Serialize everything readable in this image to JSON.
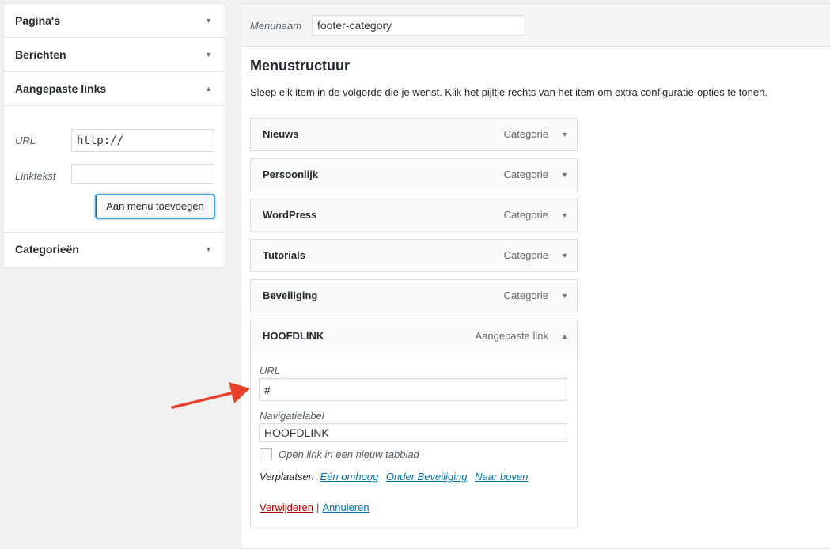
{
  "left_panel": {
    "sections": [
      {
        "label": "Pagina's"
      },
      {
        "label": "Berichten"
      },
      {
        "label": "Aangepaste links"
      },
      {
        "label": "Categorieën"
      }
    ],
    "custom_links": {
      "url_label": "URL",
      "url_value": "http://",
      "linktext_label": "Linktekst",
      "linktext_value": "",
      "add_button": "Aan menu toevoegen"
    }
  },
  "menu": {
    "name_label": "Menunaam",
    "name_value": "footer-category",
    "structure_title": "Menustructuur",
    "structure_desc": "Sleep elk item in de volgorde die je wenst. Klik het pijltje rechts van het item om extra configuratie-opties te tonen.",
    "items": [
      {
        "title": "Nieuws",
        "type": "Categorie"
      },
      {
        "title": "Persoonlijk",
        "type": "Categorie"
      },
      {
        "title": "WordPress",
        "type": "Categorie"
      },
      {
        "title": "Tutorials",
        "type": "Categorie"
      },
      {
        "title": "Beveiliging",
        "type": "Categorie"
      },
      {
        "title": "HOOFDLINK",
        "type": "Aangepaste link"
      }
    ],
    "open_item": {
      "url_label": "URL",
      "url_value": "#",
      "nav_label": "Navigatielabel",
      "nav_value": "HOOFDLINK",
      "new_tab_label": "Open link in een nieuw tabblad",
      "move_label": "Verplaatsen",
      "move_links": [
        "Eén omhoog",
        "Onder Beveiliging",
        "Naar boven"
      ],
      "delete_label": "Verwijderen",
      "separator": "|",
      "cancel_label": "Annuleren"
    }
  },
  "colors": {
    "link": "#0073aa",
    "delete": "#a00000",
    "annotation_arrow": "#e8412c"
  },
  "icons": {
    "collapsed": "triangle-down",
    "expanded": "triangle-up"
  }
}
